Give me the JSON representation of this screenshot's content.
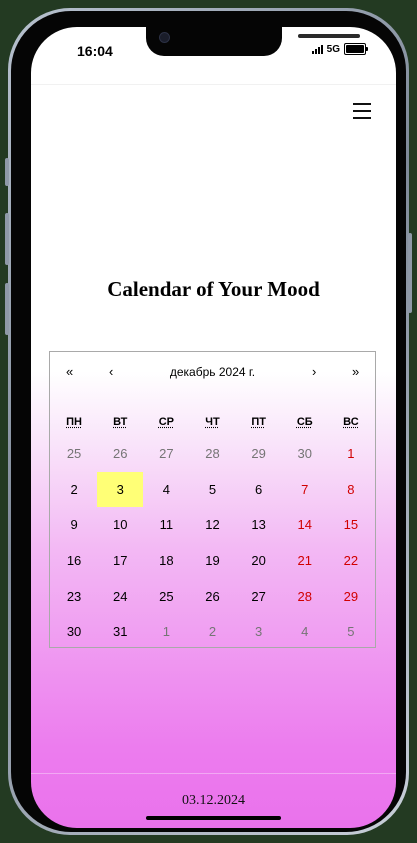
{
  "status_bar": {
    "time": "16:04",
    "network": "5G"
  },
  "page": {
    "title": "Calendar of Your Mood",
    "selected_date": "03.12.2024"
  },
  "calendar": {
    "nav": {
      "prev_year": "«",
      "prev_month": "‹",
      "label": "декабрь 2024 г.",
      "next_month": "›",
      "next_year": "»"
    },
    "weekdays": [
      "ПН",
      "ВТ",
      "СР",
      "ЧТ",
      "ПТ",
      "СБ",
      "ВС"
    ],
    "days": [
      {
        "label": "25",
        "outside": true,
        "weekend": false
      },
      {
        "label": "26",
        "outside": true,
        "weekend": false
      },
      {
        "label": "27",
        "outside": true,
        "weekend": false
      },
      {
        "label": "28",
        "outside": true,
        "weekend": false
      },
      {
        "label": "29",
        "outside": true,
        "weekend": false
      },
      {
        "label": "30",
        "outside": true,
        "weekend": false
      },
      {
        "label": "1",
        "outside": false,
        "weekend": true
      },
      {
        "label": "2",
        "outside": false,
        "weekend": false
      },
      {
        "label": "3",
        "outside": false,
        "weekend": false,
        "today": true
      },
      {
        "label": "4",
        "outside": false,
        "weekend": false
      },
      {
        "label": "5",
        "outside": false,
        "weekend": false
      },
      {
        "label": "6",
        "outside": false,
        "weekend": false
      },
      {
        "label": "7",
        "outside": false,
        "weekend": true
      },
      {
        "label": "8",
        "outside": false,
        "weekend": true
      },
      {
        "label": "9",
        "outside": false,
        "weekend": false
      },
      {
        "label": "10",
        "outside": false,
        "weekend": false
      },
      {
        "label": "11",
        "outside": false,
        "weekend": false
      },
      {
        "label": "12",
        "outside": false,
        "weekend": false
      },
      {
        "label": "13",
        "outside": false,
        "weekend": false
      },
      {
        "label": "14",
        "outside": false,
        "weekend": true
      },
      {
        "label": "15",
        "outside": false,
        "weekend": true
      },
      {
        "label": "16",
        "outside": false,
        "weekend": false
      },
      {
        "label": "17",
        "outside": false,
        "weekend": false
      },
      {
        "label": "18",
        "outside": false,
        "weekend": false
      },
      {
        "label": "19",
        "outside": false,
        "weekend": false
      },
      {
        "label": "20",
        "outside": false,
        "weekend": false
      },
      {
        "label": "21",
        "outside": false,
        "weekend": true
      },
      {
        "label": "22",
        "outside": false,
        "weekend": true
      },
      {
        "label": "23",
        "outside": false,
        "weekend": false
      },
      {
        "label": "24",
        "outside": false,
        "weekend": false
      },
      {
        "label": "25",
        "outside": false,
        "weekend": false
      },
      {
        "label": "26",
        "outside": false,
        "weekend": false
      },
      {
        "label": "27",
        "outside": false,
        "weekend": false
      },
      {
        "label": "28",
        "outside": false,
        "weekend": true
      },
      {
        "label": "29",
        "outside": false,
        "weekend": true
      },
      {
        "label": "30",
        "outside": false,
        "weekend": false
      },
      {
        "label": "31",
        "outside": false,
        "weekend": false
      },
      {
        "label": "1",
        "outside": true,
        "weekend": false
      },
      {
        "label": "2",
        "outside": true,
        "weekend": false
      },
      {
        "label": "3",
        "outside": true,
        "weekend": false
      },
      {
        "label": "4",
        "outside": true,
        "weekend": false
      },
      {
        "label": "5",
        "outside": true,
        "weekend": false
      }
    ]
  },
  "colors": {
    "today_highlight": "#ffff76",
    "weekend_text": "#d10000",
    "outside_month_text": "#757575",
    "gradient_bottom": "#ea72ec"
  },
  "icons": {
    "menu": "hamburger-menu-icon",
    "signal": "signal-bars-icon",
    "battery": "battery-icon"
  }
}
